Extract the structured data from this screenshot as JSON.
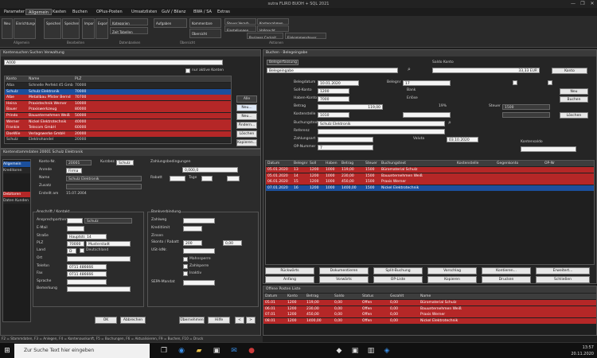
{
  "window": {
    "title": "sutra FLIRO BUOH +  SQL 2021",
    "controls": [
      "—",
      "❐",
      "✕"
    ]
  },
  "menu": [
    "Parameter",
    "Allgemein",
    "Kasten",
    "Buchen",
    "OPlus-Posten",
    "Umsatzlisten",
    "GuV / Bilanz",
    "BWA / SA",
    "Extras"
  ],
  "ribbon": {
    "buttons": [
      "Neu",
      "Einrichtungen",
      "Speichern",
      "Speichern u. Schließen",
      "Import",
      "Export",
      "Kategorien",
      "Zeit Tabellen",
      "Aufgaben",
      "Kommentare",
      "Übersicht",
      "Steuer Verarb.",
      "Einstellungen",
      "Kontenrahmen",
      "Vollmacht",
      "Business Cockpit",
      "Einkommensteuer"
    ],
    "groups": [
      "Allgemein",
      "Bearbeiten",
      "Datenbanken",
      "Übersicht",
      "Aktionen"
    ]
  },
  "left_panel": {
    "title": "Kontensuchen Suchen Verwaltung",
    "search_value": "A000",
    "checkbox_label": "nur aktive Konten",
    "columns": [
      "Konto",
      "Name",
      "PLZ"
    ],
    "rows": [
      {
        "kto": "Alba",
        "name": "Schnelle Perfekt 45 GmbH",
        "plz": "70000",
        "style": "dk"
      },
      {
        "kto": "Schulz",
        "name": "Schulz Elektronik",
        "plz": "70000",
        "style": "blue"
      },
      {
        "kto": "Albe",
        "name": "Metallbau Pfister Bernd",
        "plz": "70700",
        "style": "red"
      },
      {
        "kto": "Heina",
        "name": "Praxistechnik Werner",
        "plz": "10000",
        "style": "red"
      },
      {
        "kto": "Bauer",
        "name": "Praxiswerkzeug",
        "plz": "80000",
        "style": "red"
      },
      {
        "kto": "Prindo",
        "name": "Bauunternehmen Weiß",
        "plz": "50000",
        "style": "red"
      },
      {
        "kto": "Werner",
        "name": "Nickel Elektrotechnik",
        "plz": "40000",
        "style": "red"
      },
      {
        "kto": "Frankie",
        "name": "Telecom GmbH",
        "plz": "60000",
        "style": "red"
      },
      {
        "kto": "DoeWie",
        "name": "Verlagswerke GmbH",
        "plz": "20000",
        "style": "red"
      },
      {
        "kto": "Schulz",
        "name": "Elektrohandel",
        "plz": "20000",
        "style": "dk"
      }
    ],
    "side_buttons": [
      "Alle",
      "Neu...",
      "Neu...",
      "Ändern...",
      "Löschen",
      "Kopieren..."
    ]
  },
  "detail_panel": {
    "title": "Kontenstammdaten 20001 Schulz Elektronik",
    "tree_items": [
      "Allgemein",
      "Kreditoren",
      "Debitoren",
      "Daten Kunden"
    ],
    "fields": {
      "konto_label": "Konto-Nr.",
      "konto_value": "20001",
      "anrede_label": "Anrede",
      "anrede_value": "Firma",
      "name_label": "Name",
      "name_value": "Schulz Elektronik",
      "zusatz_label": "Zusatz",
      "zusatz_value": "",
      "erstellt_label": "Erstellt am",
      "erstellt_value": "15.07.2004",
      "kurz_label": "Kurzbez.",
      "kurz_value": "Schulz",
      "section_address": "Anschrift / Kontakt",
      "ansprech_label": "Ansprechpartner",
      "ansprech_value": "Schulz",
      "strasse_label": "Straße",
      "strasse_value": "Hauptstr. 14",
      "plz_label": "PLZ",
      "plz_value": "70000",
      "ort_label": "Ort",
      "ort_value": "Musterstadt",
      "land_label": "Land",
      "land_value": "D",
      "land_name": "Deutschland",
      "email_label": "E-Mail",
      "email_value": "",
      "tel_label": "Telefon",
      "tel_value": "0711 486666",
      "fax_label": "Fax",
      "fax_value": "0711 486666",
      "sprache_label": "Sprache",
      "sprache_value": "",
      "bemerkung_label": "Bemerkung",
      "bemerkung_value": "",
      "section_zahl": "Zahlungsbedingungen",
      "zb_value": "0,000,0",
      "rabatt_label": "Rabatt",
      "tage_label": "Tage",
      "section_fin": "Bankverbindung",
      "zahlweg_label": "Zahlweg",
      "kredit_label": "Kreditlimit",
      "zinsen_label": "Zinsen",
      "skonto_label": "Skonto / Rabatt",
      "skonto_value": "200",
      "rabatt_value": "0,00",
      "ust_label": "USt-IdNr.",
      "cb1": "Mahnsperre",
      "cb2": "Zahlsperre",
      "cb3": "Inaktiv",
      "sepa_label": "SEPA-Mandat"
    },
    "bottom_buttons": [
      "OK",
      "Abbrechen",
      "Übernehmen",
      "Hilfe"
    ]
  },
  "right_panel": {
    "title": "Buchen - Belegeingabe",
    "tab": "Belegerfassung",
    "dropdown_value": "Belegeingabe",
    "saldo_title": "Saldo Konto",
    "saldo_value": "33,33 EUR",
    "saldo_btn": "Konto",
    "fields": {
      "beleg_label": "Belegdatum",
      "beleg_value": "10.01.2020",
      "belegnr_label": "Belegnr",
      "belegnr_value": "17",
      "soll_label": "Soll-Konto",
      "soll_value": "1200",
      "soll_name": "Bank",
      "haben_label": "Haben-Konto",
      "haben_value": "7000",
      "haben_name": "Erlöse",
      "betrag_label": "Betrag",
      "betrag_value": "119,00",
      "steuer_label": "Steuer",
      "steuer_value": "1500",
      "steuer_pct": "19%",
      "kost_label": "Kostenstelle",
      "kost_value": "1010",
      "text_label": "Buchungstext",
      "text_value": "Schulz Elektronik",
      "ref_label": "Referenz",
      "ref_value": "",
      "zahl_label": "Zahlungsart",
      "zahl_value": "03.10.2020",
      "valuta_label": "Valuta",
      "valuta_value": "03.10.2020",
      "opnr_label": "OP-Nummer",
      "opnr_value": "7",
      "saldo_kt_label": "Saldo",
      "saldo_kt_value": "33,33",
      "kontensaldo_label": "Kontensaldo"
    },
    "side_buttons": [
      "Neu",
      "Buchen",
      "Löschen"
    ],
    "grid_columns": [
      "Datum",
      "Belegnr",
      "Soll",
      "Haben",
      "Betrag",
      "Steuer",
      "Buchungstext",
      "Kostenstelle",
      "Gegenkonto",
      "OP-Nr"
    ],
    "grid_rows": [
      {
        "datum": "05.01.2020",
        "beleg": "13",
        "soll": "1200",
        "haben": "1000",
        "betrag": "119,00",
        "st": "1500",
        "text": "Büromaterial Schulz",
        "style": "red"
      },
      {
        "datum": "05.01.2020",
        "beleg": "14",
        "soll": "1200",
        "haben": "1000",
        "betrag": "230,00",
        "st": "1500",
        "text": "Bauunternehmen Weiß",
        "style": "red"
      },
      {
        "datum": "06.01.2020",
        "beleg": "15",
        "soll": "1200",
        "haben": "1000",
        "betrag": "450,00",
        "st": "1500",
        "text": "Praxis Werner",
        "style": "red"
      },
      {
        "datum": "07.01.2020",
        "beleg": "16",
        "soll": "1200",
        "haben": "1000",
        "betrag": "1400,00",
        "st": "1500",
        "text": "Nickel Elektrotechnik",
        "style": "blue"
      }
    ],
    "action_buttons_row1": [
      "Rückwärts",
      "Dokumentieren",
      "Split-Buchung",
      "Vorschlag",
      "Kontieren...",
      "Erweitert..."
    ],
    "action_buttons_row2": [
      "Anfang",
      "Vorwärts",
      "OP-Liste",
      "Kopieren",
      "Drucken",
      "Schließen"
    ],
    "op_title": "Offene Posten Liste",
    "op_columns": [
      "Datum",
      "Konto",
      "Betrag",
      "Saldo",
      "Status",
      "Gezahlt",
      "Name"
    ],
    "op_rows": [
      {
        "d": "05.01",
        "k": "1200",
        "b": "119,00",
        "s": "0,00",
        "st": "Offen",
        "g": "0,00",
        "n": "Büromaterial Schulz",
        "style": "red"
      },
      {
        "d": "06.01",
        "k": "1200",
        "b": "230,00",
        "s": "0,00",
        "st": "Offen",
        "g": "0,00",
        "n": "Bauunternehmen Weiß",
        "style": "red"
      },
      {
        "d": "07.01",
        "k": "1200",
        "b": "450,00",
        "s": "0,00",
        "st": "Offen",
        "g": "0,00",
        "n": "Praxis Werner",
        "style": "red"
      },
      {
        "d": "08.01",
        "k": "1200",
        "b": "1400,00",
        "s": "0,00",
        "st": "Offen",
        "g": "0,00",
        "n": "Nickel Elektrotechnik",
        "style": "red"
      }
    ]
  },
  "status_bar": "F2 = Stammdaten, F3 = Anlegen, F4 = Kontenauskunft, F5 = Buchungen, F6 = Aktualisieren, F9 = Buchen, F10 = Druck",
  "taskbar": {
    "search_placeholder": "Zur Suche Text hier eingeben",
    "time": "13:57",
    "date": "20.11.2020"
  },
  "colors": {
    "accent_red": "#b52727",
    "accent_blue": "#1b4f9c",
    "background": "#1e1e1e"
  }
}
